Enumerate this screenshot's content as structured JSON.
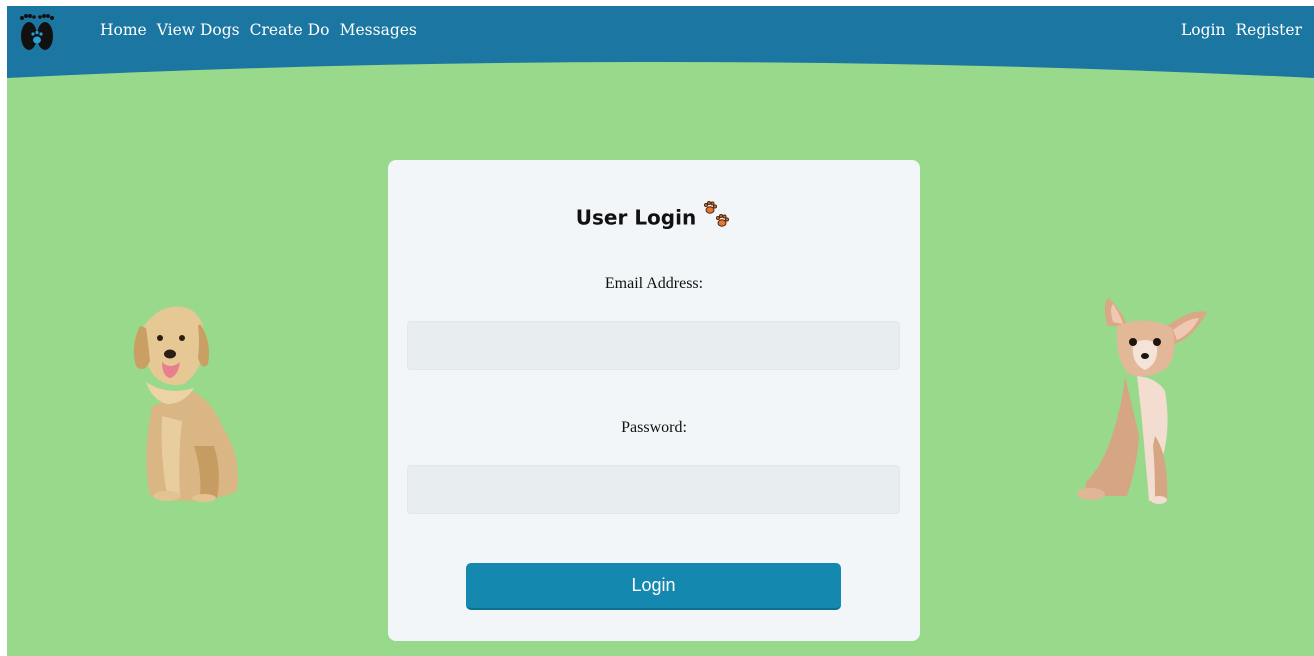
{
  "nav": {
    "left": [
      "Home",
      "View Dogs",
      "Create Dog",
      "Messages"
    ],
    "right": [
      "Login",
      "Register"
    ]
  },
  "login": {
    "title": "User Login",
    "email_label": "Email Address:",
    "email_value": "",
    "password_label": "Password:",
    "password_value": "",
    "submit_label": "Login"
  },
  "icons": {
    "logo": "footprints-icon",
    "title_icon": "paw-prints-icon"
  },
  "colors": {
    "header": "#1b77a1",
    "background": "#99d98b",
    "card": "#f2f6f8",
    "input": "#e8edef",
    "button": "#1588b0",
    "paw": "#e8762b"
  }
}
